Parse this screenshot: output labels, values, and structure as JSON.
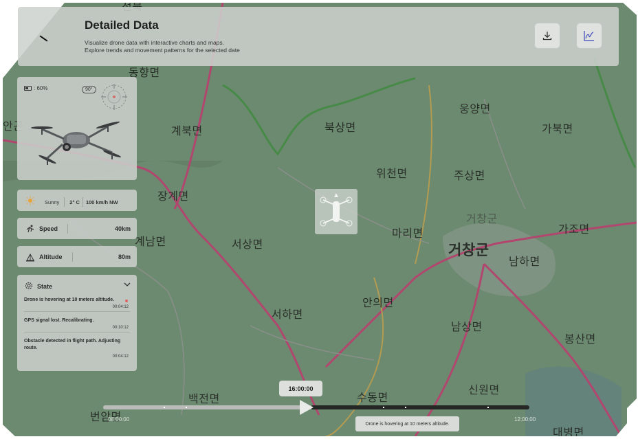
{
  "header": {
    "title": "Detailed Data",
    "subtitle_line1": "Visualize drone data with interactive charts and maps.",
    "subtitle_line2": "Explore trends and movement patterns for the selected date",
    "download_icon": "download-icon",
    "chart_icon": "line-chart-icon"
  },
  "drone": {
    "battery": ": 60%",
    "heading": "90°"
  },
  "weather": {
    "condition": "Sunny",
    "temperature": "2° C",
    "wind": "100 km/h NW"
  },
  "speed": {
    "label": "Speed",
    "value": "40km"
  },
  "altitude": {
    "label": "Altitude",
    "value": "80m"
  },
  "state": {
    "title": "State",
    "messages": [
      {
        "text": "Drone is hovering at 10 meters altitude.",
        "time": "00:04:12",
        "alert": true
      },
      {
        "text": "GPS signal lost. Recalibrating.",
        "time": "00:10:12",
        "alert": false
      },
      {
        "text": "Obstacle detected in flight path. Adjusting route.",
        "time": "00:04:12",
        "alert": false
      }
    ]
  },
  "timeline": {
    "current": "16:00:00",
    "start": "08:00:00",
    "end": "12:00:00",
    "tooltip": "Drone is hovering at 10 meters altitude.",
    "progress": 0.47
  },
  "map": {
    "labels": [
      "동향면",
      "안곤",
      "계북면",
      "장계면",
      "계남면",
      "서상면",
      "서하면",
      "백전면",
      "번암면",
      "북상면",
      "위천면",
      "마리면",
      "안의면",
      "수동면",
      "웅양면",
      "주상면",
      "거창군",
      "가북면",
      "가조면",
      "남하면",
      "남상면",
      "신원면",
      "봉산면",
      "대병면",
      "거창군",
      "전북"
    ]
  },
  "colors": {
    "accent": "#e56262",
    "panel": "#cbcecb",
    "map_green": "#6c8a6f",
    "road": "#c44a78"
  }
}
